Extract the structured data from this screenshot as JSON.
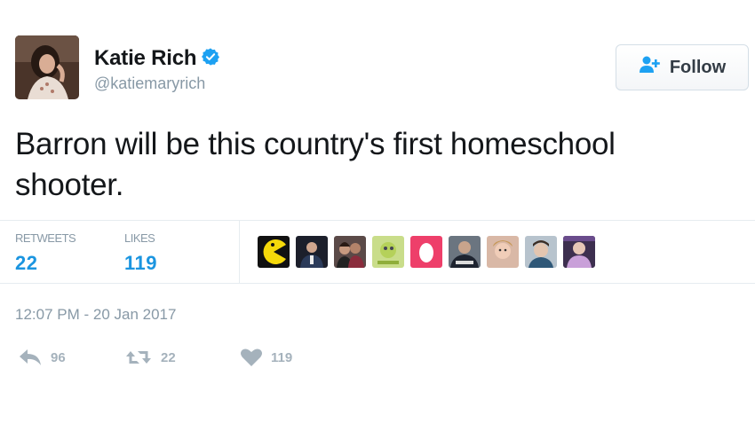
{
  "user": {
    "name": "Katie Rich",
    "handle": "@katiemaryrich",
    "verified": true
  },
  "follow_button": {
    "label": "Follow"
  },
  "tweet": {
    "text": "Barron will be this country's first homeschool shooter."
  },
  "stats": {
    "retweets_label": "RETWEETS",
    "retweets_value": "22",
    "likes_label": "LIKES",
    "likes_value": "119"
  },
  "likers": [
    {
      "name": "pacman-avatar"
    },
    {
      "name": "liker-avatar-2"
    },
    {
      "name": "liker-avatar-3"
    },
    {
      "name": "liker-avatar-4"
    },
    {
      "name": "pink-egg-avatar"
    },
    {
      "name": "liker-avatar-6"
    },
    {
      "name": "liker-avatar-7"
    },
    {
      "name": "liker-avatar-8"
    },
    {
      "name": "liker-avatar-9"
    }
  ],
  "timestamp": "12:07 PM - 20 Jan 2017",
  "actions": {
    "reply_count": "96",
    "retweet_count": "22",
    "like_count": "119"
  },
  "colors": {
    "accent": "#1b95e0",
    "muted": "#8899a6",
    "icon_muted": "#a5b2bc",
    "verified": "#1da1f2"
  },
  "icons": {
    "verified": "verified-badge-icon",
    "follow": "person-add-icon",
    "reply": "reply-icon",
    "retweet": "retweet-icon",
    "like": "heart-icon"
  }
}
